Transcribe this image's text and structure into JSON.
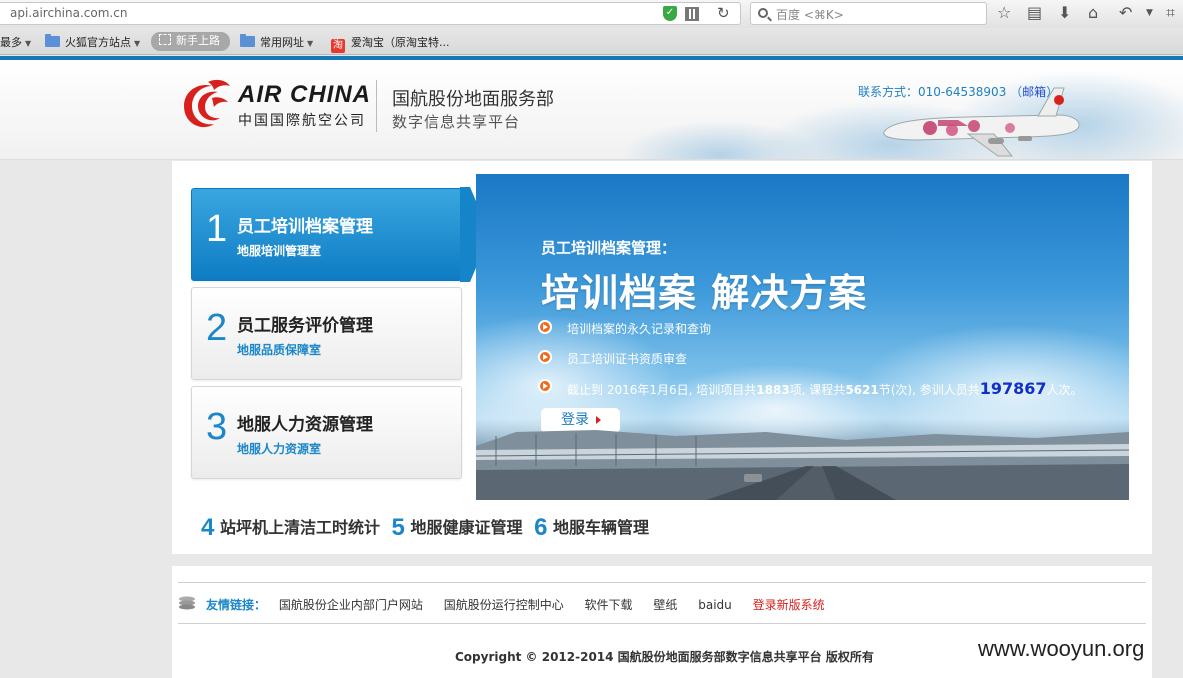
{
  "browser": {
    "url": "api.airchina.com.cn",
    "search_placeholder": "百度 <⌘K>",
    "bookmarks": {
      "most_visited": "最多",
      "firefox_official": "火狐官方站点",
      "getting_started": "新手上路",
      "common_sites": "常用网址",
      "taobao": "爱淘宝（原淘宝特..."
    }
  },
  "header": {
    "brand_en": "AIR CHINA",
    "brand_cn": "中国国際航空公司",
    "dept_title": "国航股份地面服务部",
    "dept_subtitle": "数字信息共享平台",
    "contact_label": "联系方式：",
    "contact_phone": "010-64538903",
    "contact_mail_open": "（",
    "contact_mail": "邮箱",
    "contact_mail_close": "）"
  },
  "menu": [
    {
      "num": "1",
      "title": "员工培训档案管理",
      "subtitle": "地服培训管理室",
      "active": true
    },
    {
      "num": "2",
      "title": "员工服务评价管理",
      "subtitle": "地服品质保障室",
      "active": false
    },
    {
      "num": "3",
      "title": "地服人力资源管理",
      "subtitle": "地服人力资源室",
      "active": false
    }
  ],
  "banner": {
    "label": "员工培训档案管理：",
    "title": "培训档案 解决方案",
    "item1": "培训档案的永久记录和查询",
    "item2": "员工培训证书资质审查",
    "stat_prefix": "截止到 2016年1月6日, 培训项目共",
    "stat_projects": "1883",
    "stat_mid1": "项, 课程共",
    "stat_courses": "5621",
    "stat_mid2": "节(次), 参训人员共",
    "stat_people": "197867",
    "stat_suffix": "人次。",
    "login_label": "登录"
  },
  "quick_links": [
    {
      "num": "4",
      "label": "站坪机上清洁工时统计"
    },
    {
      "num": "5",
      "label": "地服健康证管理"
    },
    {
      "num": "6",
      "label": "地服车辆管理"
    }
  ],
  "footer": {
    "links_label": "友情链接：",
    "links": [
      "国航股份企业内部门户网站",
      "国航股份运行控制中心",
      "软件下载",
      "壁纸",
      "baidu"
    ],
    "new_system": "登录新版系统",
    "copyright": "Copyright © 2012-2014 国航股份地面服务部数字信息共享平台 版权所有"
  },
  "watermark": "www.wooyun.org",
  "colors": {
    "accent_blue": "#1b87c9",
    "brand_red": "#d8211e",
    "header_rule": "#1478b6"
  }
}
